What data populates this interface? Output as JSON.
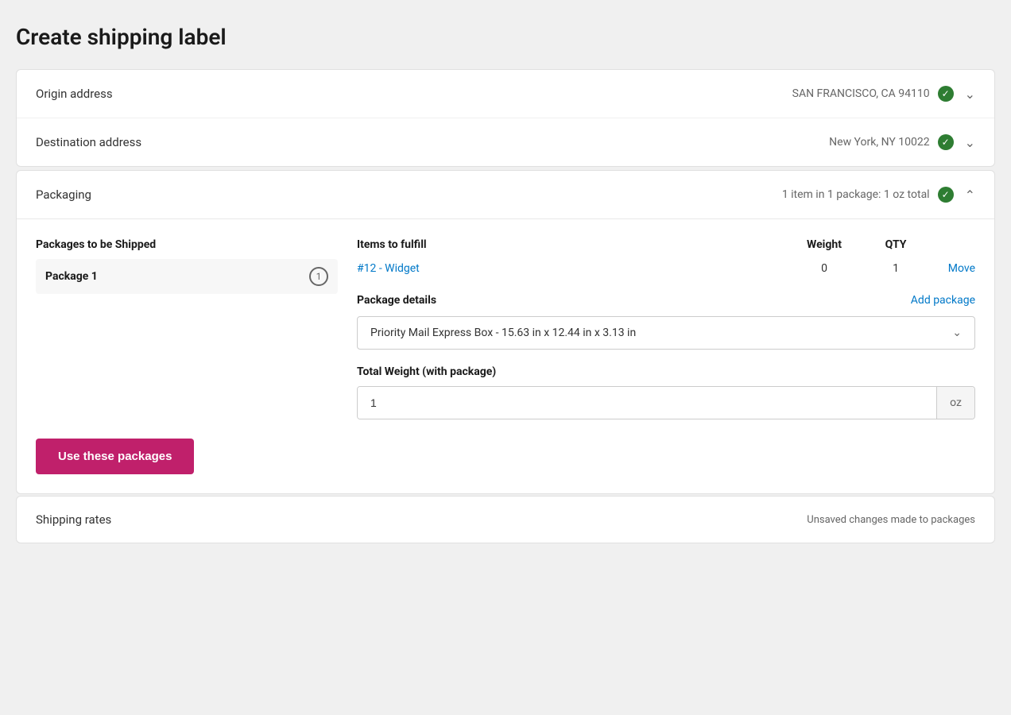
{
  "page": {
    "title": "Create shipping label"
  },
  "origin": {
    "label": "Origin address",
    "status": "SAN FRANCISCO, CA  94110",
    "verified": true
  },
  "destination": {
    "label": "Destination address",
    "status": "New York, NY  10022",
    "verified": true
  },
  "packaging": {
    "label": "Packaging",
    "summary": "1 item in 1 package: 1 oz total",
    "verified": true,
    "columns": {
      "packages": "Packages to be Shipped",
      "items": "Items to fulfill",
      "weight": "Weight",
      "qty": "QTY"
    },
    "package1": {
      "name": "Package 1",
      "badge": "1",
      "item_link": "#12 - Widget",
      "item_weight": "0",
      "item_qty": "1",
      "move_label": "Move"
    },
    "package_details": {
      "label": "Package details",
      "add_package": "Add package",
      "selected_box": "Priority Mail Express Box - 15.63 in x 12.44 in x 3.13 in"
    },
    "total_weight": {
      "label": "Total Weight (with package)",
      "value": "1",
      "unit": "oz"
    }
  },
  "use_packages_btn": "Use these packages",
  "shipping_rates": {
    "label": "Shipping rates",
    "right_text": "Unsaved changes made to packages"
  }
}
